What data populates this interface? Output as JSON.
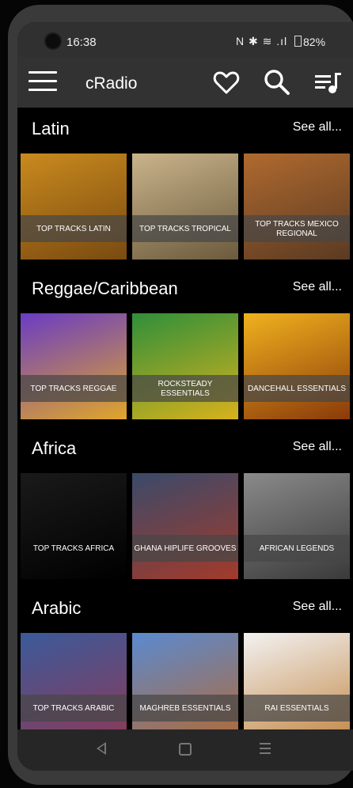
{
  "status_bar": {
    "time": "16:38",
    "icons": "N ✱ ≋ .ıl",
    "battery": "82%"
  },
  "app_bar": {
    "title": "cRadio",
    "icons": [
      "menu-icon",
      "heart-icon",
      "search-icon",
      "queue-music-icon"
    ]
  },
  "sections": [
    {
      "title": "Latin",
      "see_all": "See all...",
      "tiles": [
        {
          "label": "TOP TRACKS LATIN",
          "colors": [
            "#c98a1e",
            "#7a4a10"
          ]
        },
        {
          "label": "TOP TRACKS TROPICAL",
          "colors": [
            "#c9b48a",
            "#6b5a3d"
          ]
        },
        {
          "label": "TOP TRACKS MEXICO REGIONAL",
          "colors": [
            "#b06a2f",
            "#5a3a22"
          ]
        }
      ]
    },
    {
      "title": "Reggae/Caribbean",
      "see_all": "See all...",
      "tiles": [
        {
          "label": "TOP TRACKS REGGAE",
          "colors": [
            "#6a3cc4",
            "#e0a62a"
          ]
        },
        {
          "label": "ROCKSTEADY ESSENTIALS",
          "colors": [
            "#2f8f3a",
            "#d8b21c"
          ]
        },
        {
          "label": "DANCEHALL ESSENTIALS",
          "colors": [
            "#f0b21e",
            "#8a3a0a"
          ]
        }
      ]
    },
    {
      "title": "Africa",
      "see_all": "See all...",
      "tiles": [
        {
          "label": "TOP TRACKS AFRICA",
          "colors": [
            "#1a1a1a",
            "#000000"
          ]
        },
        {
          "label": "GHANA HIPLIFE GROOVES",
          "colors": [
            "#3a4a6a",
            "#a33a2a"
          ]
        },
        {
          "label": "AFRICAN LEGENDS",
          "colors": [
            "#8a8a8a",
            "#3a3a3a"
          ]
        }
      ]
    },
    {
      "title": "Arabic",
      "see_all": "See all...",
      "tiles": [
        {
          "label": "TOP TRACKS ARABIC",
          "colors": [
            "#3a5a9a",
            "#8a3a5a"
          ]
        },
        {
          "label": "MAGHREB ESSENTIALS",
          "colors": [
            "#5a8ad0",
            "#b06a3a"
          ]
        },
        {
          "label": "RAI ESSENTIALS",
          "colors": [
            "#f2f2f2",
            "#c48a4a"
          ]
        }
      ]
    }
  ],
  "nav_bar": {
    "icons": [
      "back-icon",
      "home-icon",
      "recents-icon"
    ]
  }
}
